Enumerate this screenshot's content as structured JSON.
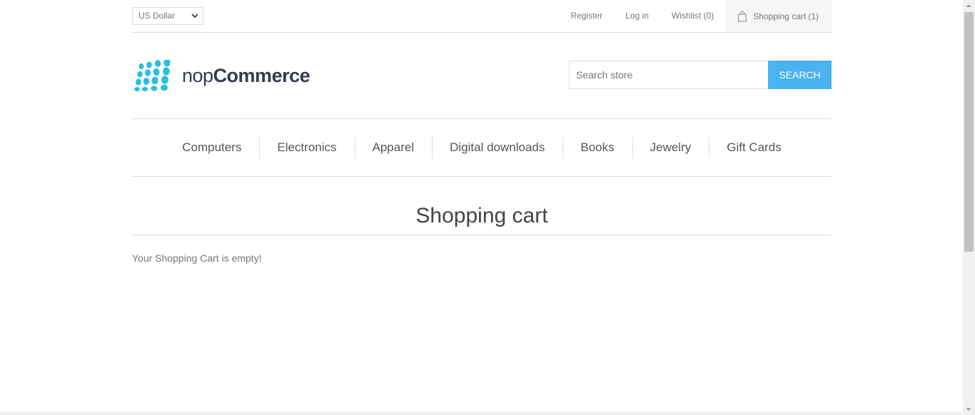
{
  "header": {
    "currency": "US Dollar",
    "links": {
      "register": "Register",
      "login": "Log in",
      "wishlist": "Wishlist (0)",
      "cart_label": "Shopping cart",
      "cart_count": "(1)"
    }
  },
  "logo": {
    "prefix": "nop",
    "suffix": "Commerce",
    "dot_color": "#29c0e0"
  },
  "search": {
    "placeholder": "Search store",
    "button_label": "Search"
  },
  "menu": {
    "items": [
      "Computers",
      "Electronics",
      "Apparel",
      "Digital downloads",
      "Books",
      "Jewelry",
      "Gift Cards"
    ]
  },
  "main": {
    "title": "Shopping cart",
    "empty_message": "Your Shopping Cart is empty!"
  },
  "colors": {
    "accent": "#4ab2f1",
    "border": "#dddddd",
    "cart_bg": "#f6f6f6"
  }
}
